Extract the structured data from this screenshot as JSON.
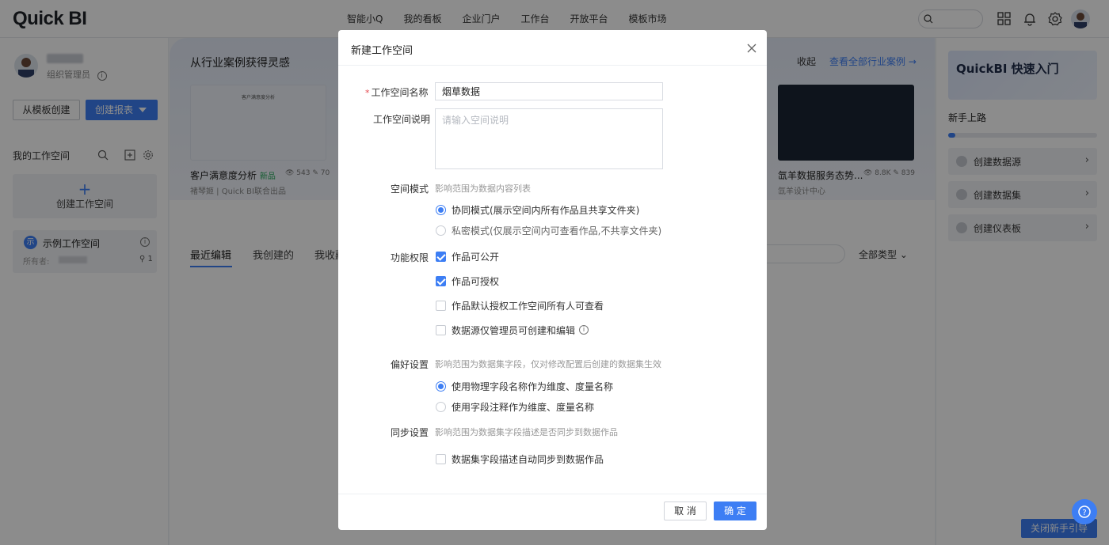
{
  "app": {
    "logo": "Quick BI"
  },
  "nav": {
    "items": [
      "智能小Q",
      "我的看板",
      "企业门户",
      "工作台",
      "开放平台",
      "模板市场"
    ]
  },
  "user": {
    "role": "组织管理员"
  },
  "left": {
    "btn_template": "从模板创建",
    "btn_create": "创建报表",
    "my_workspace": "我的工作空间",
    "new_workspace": "创建工作空间",
    "workspace": {
      "badge": "示",
      "name": "示例工作空间",
      "owner_label": "所有者:",
      "member_count": "1"
    }
  },
  "banner": {
    "title": "从行业案例获得灵感",
    "collapse": "收起",
    "view_all": "查看全部行业案例 →",
    "card1": {
      "thumb_title": "客户满意度分析",
      "name": "客户满意度分析",
      "tag": "新品",
      "views": "543",
      "edits": "70",
      "sub": "褚琴姬 | Quick BI联合出品"
    },
    "card2": {
      "name": "氙羊数据服务态势...",
      "views": "8.8K",
      "edits": "839",
      "sub": "氙羊设计中心"
    }
  },
  "tabs": {
    "items": [
      "最近编辑",
      "我创建的",
      "我收藏"
    ],
    "type_filter": "全部类型"
  },
  "right": {
    "quickstart": "QuickBI 快速入门",
    "guide_title": "新手上路",
    "progress": 0.05,
    "items": [
      "创建数据源",
      "创建数据集",
      "创建仪表板"
    ],
    "close_guide": "关闭新手引导"
  },
  "modal": {
    "title": "新建工作空间",
    "name_label": "工作空间名称",
    "name_value": "烟草数据",
    "desc_label": "工作空间说明",
    "desc_placeholder": "请输入空间说明",
    "mode_label": "空间模式",
    "mode_hint": "影响范围为数据内容列表",
    "mode_options": [
      "协同模式(展示空间内所有作品且共享文件夹)",
      "私密模式(仅展示空间内可查看作品,不共享文件夹)"
    ],
    "perm_label": "功能权限",
    "perm_options": [
      "作品可公开",
      "作品可授权",
      "作品默认授权工作空间所有人可查看",
      "数据源仅管理员可创建和编辑"
    ],
    "pref_label": "偏好设置",
    "pref_hint": "影响范围为数据集字段，仅对修改配置后创建的数据集生效",
    "pref_options": [
      "使用物理字段名称作为维度、度量名称",
      "使用字段注释作为维度、度量名称"
    ],
    "sync_label": "同步设置",
    "sync_hint": "影响范围为数据集字段描述是否同步到数据作品",
    "sync_options": [
      "数据集字段描述自动同步到数据作品"
    ],
    "cancel": "取 消",
    "ok": "确 定"
  },
  "colors": {
    "accent": "#3d7ef4",
    "mask": "rgba(0,0,0,0.45)",
    "required": "#e5484d"
  }
}
